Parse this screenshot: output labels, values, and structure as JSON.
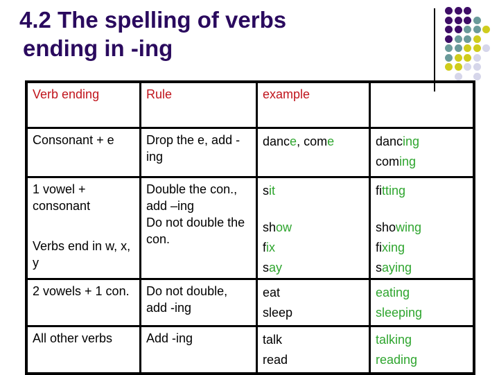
{
  "title": {
    "line1": "4.2 The spelling of verbs",
    "line2": "ending in -ing"
  },
  "colors": {
    "title": "#2a0a5e",
    "header_text": "#c0141c",
    "highlight_green": "#2ea52e",
    "dot_purple": "#3d0c66",
    "dot_teal": "#6a9a9a",
    "dot_yellow": "#cfcc1c",
    "dot_lavender": "#d6d6ea"
  },
  "table": {
    "headers": [
      "Verb ending",
      "Rule",
      "example",
      ""
    ],
    "rows": [
      {
        "ending": "Consonant + e",
        "rule": "Drop the e, add -ing",
        "examples": [
          [
            {
              "t": "danc",
              "h": false
            },
            {
              "t": "e",
              "h": true
            },
            {
              "t": ", com",
              "h": false
            },
            {
              "t": "e",
              "h": true
            }
          ]
        ],
        "results": [
          [
            {
              "t": "danc",
              "h": false
            },
            {
              "t": "ing",
              "h": true
            }
          ],
          [
            {
              "t": "com",
              "h": false
            },
            {
              "t": "ing",
              "h": true
            }
          ]
        ]
      },
      {
        "ending": "1 vowel + consonant",
        "ending_sub": "Verbs end in w, x, y",
        "rule": "Double the con., add –ing",
        "rule_sub": "Do not double the con.",
        "examples": [
          [
            {
              "t": "s",
              "h": false
            },
            {
              "t": "it",
              "h": true
            }
          ],
          [],
          [
            {
              "t": "sh",
              "h": false
            },
            {
              "t": "ow",
              "h": true
            }
          ],
          [
            {
              "t": "f",
              "h": false
            },
            {
              "t": "ix",
              "h": true
            }
          ],
          [
            {
              "t": "s",
              "h": false
            },
            {
              "t": "ay",
              "h": true
            }
          ]
        ],
        "results": [
          [
            {
              "t": "fi",
              "h": false
            },
            {
              "t": "tting",
              "h": true
            }
          ],
          [],
          [
            {
              "t": "sho",
              "h": false
            },
            {
              "t": "wing",
              "h": true
            }
          ],
          [
            {
              "t": "fi",
              "h": false
            },
            {
              "t": "xing",
              "h": true
            }
          ],
          [
            {
              "t": "s",
              "h": false
            },
            {
              "t": "aying",
              "h": true
            }
          ]
        ]
      },
      {
        "ending": "2 vowels + 1 con.",
        "rule": "Do not double, add -ing",
        "examples": [
          [
            {
              "t": "eat",
              "h": false
            }
          ],
          [
            {
              "t": "sleep",
              "h": false
            }
          ]
        ],
        "results": [
          [
            {
              "t": "eating",
              "h": true
            }
          ],
          [
            {
              "t": "sleeping",
              "h": true
            }
          ]
        ]
      },
      {
        "ending": "All other verbs",
        "rule": "Add -ing",
        "examples": [
          [
            {
              "t": "talk",
              "h": false
            }
          ],
          [
            {
              "t": "read",
              "h": false
            }
          ]
        ],
        "results": [
          [
            {
              "t": "talking",
              "h": true
            }
          ],
          [
            {
              "t": "reading",
              "h": true
            }
          ]
        ]
      }
    ]
  },
  "decoration": {
    "dot_grid": [
      [
        "purple",
        "purple",
        "purple",
        null,
        null
      ],
      [
        "purple",
        "purple",
        "purple",
        "teal",
        null
      ],
      [
        "purple",
        "purple",
        "teal",
        "teal",
        "yellow"
      ],
      [
        "purple",
        "teal",
        "teal",
        "yellow",
        null
      ],
      [
        "teal",
        "teal",
        "yellow",
        "yellow",
        "lavender"
      ],
      [
        "teal",
        "yellow",
        "yellow",
        "lavender",
        null
      ],
      [
        "yellow",
        "yellow",
        "lavender",
        "lavender",
        null
      ],
      [
        null,
        "lavender",
        null,
        "lavender",
        null
      ]
    ]
  }
}
